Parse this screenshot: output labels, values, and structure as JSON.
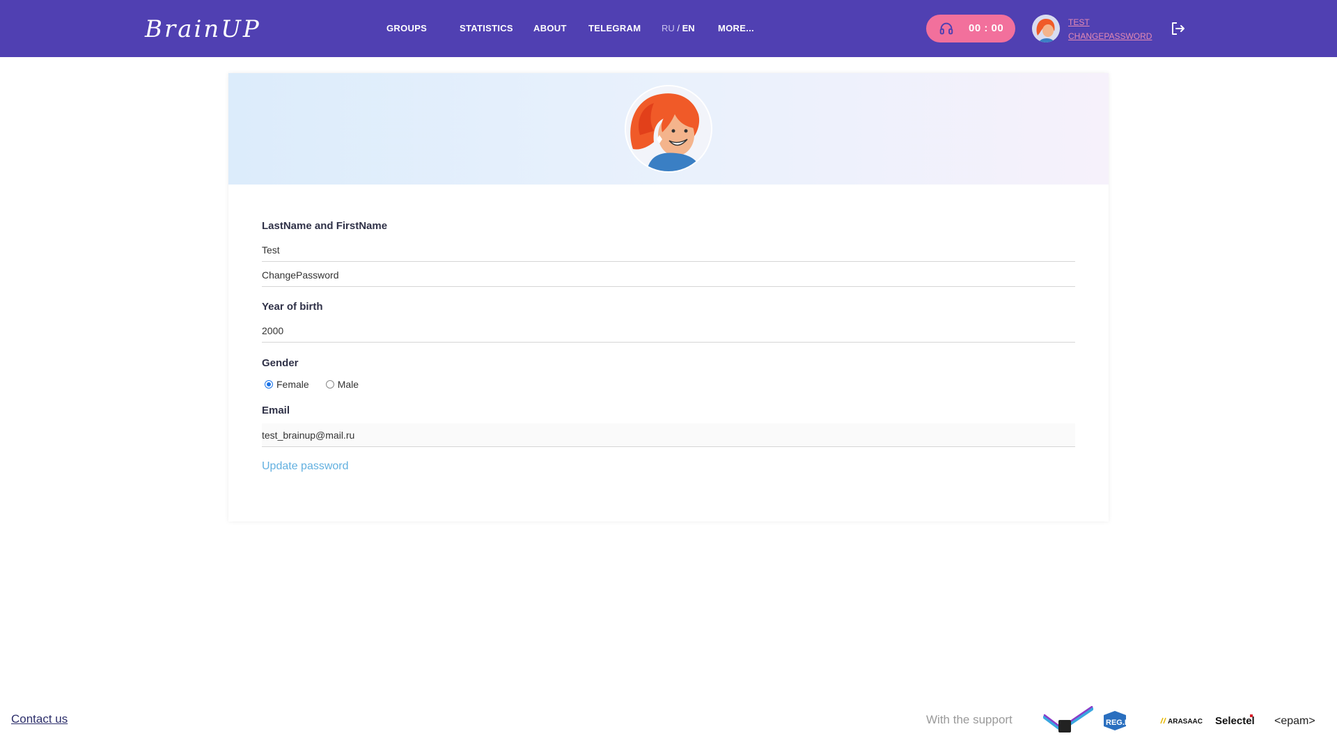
{
  "header": {
    "logo": "BrainUP",
    "nav": {
      "groups": "GROUPS",
      "statistics": "STATISTICS",
      "about": "ABOUT",
      "telegram": "TELEGRAM",
      "more": "MORE..."
    },
    "lang": {
      "ru": "RU",
      "sep": " / ",
      "en": "EN"
    },
    "timer": "00 : 00",
    "user": {
      "first": "TEST",
      "last": "CHANGEPASSWORD"
    }
  },
  "profile": {
    "name_label": "LastName and FirstName",
    "first_name": "Test",
    "last_name": "ChangePassword",
    "birth_label": "Year of birth",
    "birth_year": "2000",
    "gender_label": "Gender",
    "gender_options": [
      "Female",
      "Male"
    ],
    "gender_selected": "Female",
    "email_label": "Email",
    "email": "test_brainup@mail.ru",
    "update_password": "Update password"
  },
  "footer": {
    "contact": "Contact us",
    "support": "With the support",
    "sponsors": [
      "REG.RU",
      "ARASAAC",
      "Selectel",
      "<epam>"
    ]
  },
  "colors": {
    "header": "#5040b2",
    "timer": "#f2709c",
    "link": "#62b0e0"
  }
}
